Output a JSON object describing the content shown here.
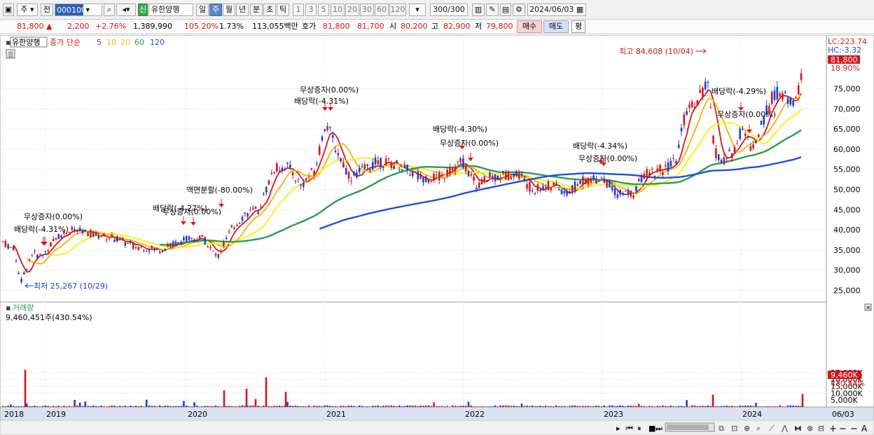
{
  "toolbar": {
    "period_type": "주",
    "prev_label": "전",
    "code": "000100",
    "market_badge": "신",
    "stock_name": "유한양행",
    "tabs": [
      "일",
      "주",
      "월",
      "년",
      "분",
      "초",
      "틱"
    ],
    "active_tab": "주",
    "intervals": [
      "1",
      "3",
      "5",
      "10",
      "20",
      "30",
      "60",
      "120"
    ],
    "count": "300",
    "count_total": "/300",
    "date": "2024/06/03"
  },
  "quote": {
    "price": "81,800",
    "arrow": "▲",
    "change": "2,200",
    "change_pct": "+2.76%",
    "volume": "1,389,990",
    "volume_ratio": "105.20%",
    "turnover": "1.73%",
    "amount": "113,055백만",
    "bid_label": "호가",
    "ask_price": "81,800",
    "bid_price": "81,700",
    "open_label": "시",
    "open": "80,200",
    "high_label": "고",
    "high": "82,900",
    "low_label": "저",
    "low": "79,800",
    "buy_button": "매수",
    "sell_button": "매도",
    "avg_button": "평"
  },
  "price_panel": {
    "legend_name": "유한양행",
    "legend_ma_label": "종가 단순",
    "ma_periods": [
      "5",
      "10",
      "20",
      "60",
      "120"
    ],
    "ma_colors": [
      "#d7141a",
      "#f0b400",
      "#ffee00",
      "#2a9d4e",
      "#1f52d0"
    ],
    "lc_label": "LC:223.74",
    "hc_label": "HC:-3.32",
    "last_price_tag": "81,800",
    "last_pct_tag": "18.90%",
    "high_annotation": "최고 84,608 (10/04)",
    "low_annotation": "최저 25,267 (10/29)",
    "price_axis": [
      "75,000",
      "70,000",
      "65,000",
      "60,000",
      "55,000",
      "50,000",
      "45,000",
      "40,000",
      "35,000",
      "30,000",
      "25,000"
    ],
    "events": [
      {
        "label": "무상증자(0.00%)"
      },
      {
        "label": "배당락(-4.31%)"
      },
      {
        "label": "배당락(-4.27%)"
      },
      {
        "label": "무상증자(0.00%)"
      },
      {
        "label": "액면분할(-80.00%)"
      },
      {
        "label": "무상증자(0.00%)"
      },
      {
        "label": "배당락(-4.31%)"
      },
      {
        "label": "배당락(-4.30%)"
      },
      {
        "label": "무상증자(0.00%)"
      },
      {
        "label": "배당락(-4.34%)"
      },
      {
        "label": "무상증자(0.00%)"
      },
      {
        "label": "배당락(-4.29%)"
      },
      {
        "label": "무상증자(0.00%)"
      }
    ]
  },
  "volume_panel": {
    "title": "거래량",
    "current": "9,460,451주(430.54%)",
    "axis": [
      "25,000K",
      "20,000K",
      "15,000K",
      "10,000K",
      "5,000K"
    ],
    "last_tag": "9,460K",
    "last_pct_tag": "430.54%"
  },
  "time_axis": {
    "labels": [
      "2018",
      "2019",
      "2020",
      "2021",
      "2022",
      "2023",
      "2024"
    ],
    "end_label": "06/03"
  },
  "colors": {
    "up": "#d7141a",
    "down": "#1a3fd0",
    "grid": "#e4e4e4"
  }
}
